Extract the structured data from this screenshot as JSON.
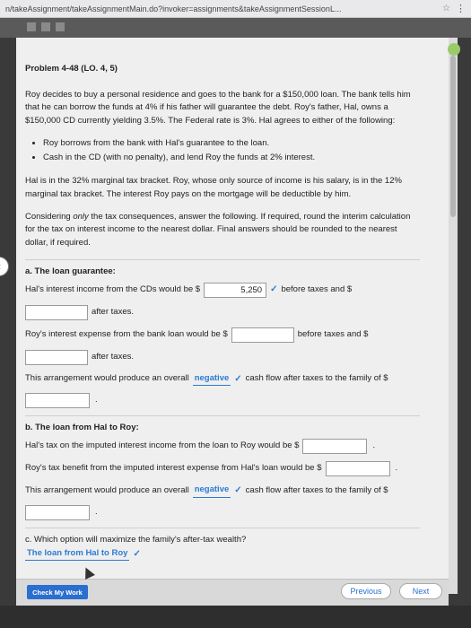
{
  "browser": {
    "url": "n/takeAssignment/takeAssignmentMain.do?invoker=assignments&takeAssignmentSessionL...",
    "star_icon": "star-icon",
    "menu_icon": "more-vert-icon"
  },
  "problem": {
    "title": "Problem 4-48 (LO. 4, 5)",
    "intro": "Roy decides to buy a personal residence and goes to the bank for a $150,000 loan. The bank tells him that he can borrow the funds at 4% if his father will guarantee the debt. Roy's father, Hal, owns a $150,000 CD currently yielding 3.5%. The Federal rate is 3%. Hal agrees to either of the following:",
    "bullets": [
      "Roy borrows from the bank with Hal's guarantee to the loan.",
      "Cash in the CD (with no penalty), and lend Roy the funds at 2% interest."
    ],
    "para2": "Hal is in the 32% marginal tax bracket. Roy, whose only source of income is his salary, is in the 12% marginal tax bracket. The interest Roy pays on the mortgage will be deductible by him.",
    "para3_pre": "Considering ",
    "para3_em": "only",
    "para3_post": " the tax consequences, answer the following. If required, round the interim calculation for the tax on interest income to the nearest dollar. Final answers should be rounded to the nearest dollar, if required."
  },
  "part_a": {
    "head": "a. The loan guarantee:",
    "q1_pre": "Hal's interest income from the CDs would be $",
    "q1_value": "5,250",
    "q1_mid": "before taxes and $",
    "q1_value2": "",
    "q1_post": "after taxes.",
    "q2_pre": "Roy's interest expense from the bank loan would be $",
    "q2_value": "",
    "q2_mid": "before taxes and $",
    "q2_value2": "",
    "q2_post": "after taxes.",
    "q3_pre": "This arrangement would produce an overall",
    "q3_answer": "negative",
    "q3_post": "cash flow after taxes to the family of $",
    "q3_value": ""
  },
  "part_b": {
    "head": "b. The loan from Hal to Roy:",
    "q1_pre": "Hal's tax on the imputed interest income from the loan to Roy would be $",
    "q1_value": "",
    "q2_pre": "Roy's tax benefit from the imputed interest expense from Hal's loan would be $",
    "q2_value": "",
    "q3_pre": "This arrangement would produce an overall",
    "q3_answer": "negative",
    "q3_post": "cash flow after taxes to the family of $",
    "q3_value": ""
  },
  "part_c": {
    "question": "c. Which option will maximize the family's after-tax wealth?",
    "answer": "The loan from Hal to Roy"
  },
  "buttons": {
    "check": "Check My Work",
    "previous": "Previous",
    "next": "Next"
  },
  "colors": {
    "accent": "#2a7bd4"
  }
}
